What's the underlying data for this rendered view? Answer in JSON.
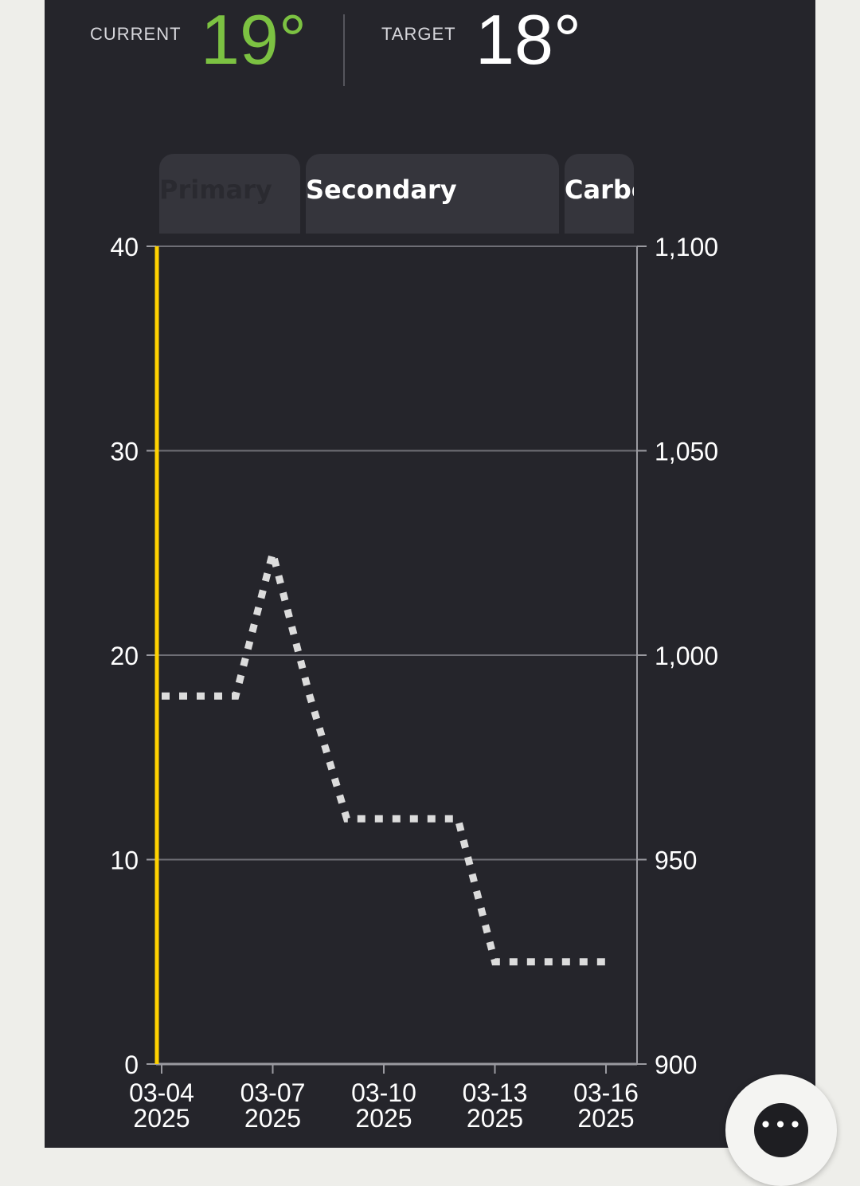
{
  "header": {
    "current_label": "CURRENT",
    "current_value": "19°",
    "target_label": "TARGET",
    "target_value": "18°",
    "current_color": "#7cc242",
    "target_color": "#ffffff"
  },
  "tabs": [
    {
      "label": "Primary",
      "state": "inactive-faded"
    },
    {
      "label": "Secondary",
      "state": "active"
    },
    {
      "label": "Carbon",
      "state": "clipped"
    }
  ],
  "menu_button": {
    "icon": "more-horizontal-icon",
    "glyph": "•••"
  },
  "chart_data": {
    "type": "line",
    "x_dates": [
      "03-04 2025",
      "03-05 2025",
      "03-06 2025",
      "03-07 2025",
      "03-08 2025",
      "03-09 2025",
      "03-10 2025",
      "03-11 2025",
      "03-12 2025",
      "03-13 2025",
      "03-14 2025",
      "03-15 2025",
      "03-16 2025"
    ],
    "x_tick_labels": [
      {
        "line1": "03-04",
        "line2": "2025"
      },
      {
        "line1": "03-07",
        "line2": "2025"
      },
      {
        "line1": "03-10",
        "line2": "2025"
      },
      {
        "line1": "03-13",
        "line2": "2025"
      },
      {
        "line1": "03-16",
        "line2": "2025"
      }
    ],
    "y_left": {
      "ticks": [
        "0",
        "10",
        "20",
        "30",
        "40"
      ],
      "range": [
        0,
        40
      ]
    },
    "y_right": {
      "ticks": [
        "900",
        "950",
        "1,000",
        "1,050",
        "1,100"
      ],
      "range": [
        900,
        1100
      ]
    },
    "grid": true,
    "series": [
      {
        "style": "dotted",
        "color": "#dcdcdc",
        "axis": "left",
        "values": [
          18,
          18,
          18,
          25,
          18,
          12,
          12,
          12,
          12,
          5,
          5,
          5,
          5
        ]
      }
    ],
    "marker": {
      "x": "03-04 2025",
      "color": "#ffd200"
    }
  }
}
